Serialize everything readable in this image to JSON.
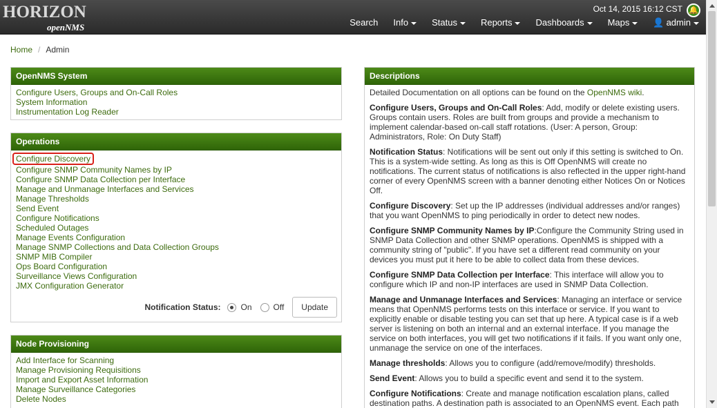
{
  "logo": {
    "brand": "HORIZON",
    "sub": "openNMS"
  },
  "header": {
    "clock": "Oct 14, 2015 16:12 CST",
    "menu": [
      {
        "label": "Search",
        "dropdown": false
      },
      {
        "label": "Info",
        "dropdown": true
      },
      {
        "label": "Status",
        "dropdown": true
      },
      {
        "label": "Reports",
        "dropdown": true
      },
      {
        "label": "Dashboards",
        "dropdown": true
      },
      {
        "label": "Maps",
        "dropdown": true
      }
    ],
    "user": "admin"
  },
  "breadcrumb": {
    "home": "Home",
    "current": "Admin"
  },
  "system": {
    "title": "OpenNMS System",
    "links": [
      "Configure Users, Groups and On-Call Roles",
      "System Information",
      "Instrumentation Log Reader"
    ]
  },
  "operations": {
    "title": "Operations",
    "links": [
      "Configure Discovery",
      "Configure SNMP Community Names by IP",
      "Configure SNMP Data Collection per Interface",
      "Manage and Unmanage Interfaces and Services",
      "Manage Thresholds",
      "Send Event",
      "Configure Notifications",
      "Scheduled Outages",
      "Manage Events Configuration",
      "Manage SNMP Collections and Data Collection Groups",
      "SNMP MIB Compiler",
      "Ops Board Configuration",
      "Surveillance Views Configuration",
      "JMX Configuration Generator"
    ],
    "notification_label": "Notification Status:",
    "on_label": "On",
    "off_label": "Off",
    "selected": "On",
    "update_label": "Update"
  },
  "provisioning": {
    "title": "Node Provisioning",
    "links": [
      "Add Interface for Scanning",
      "Manage Provisioning Requisitions",
      "Import and Export Asset Information",
      "Manage Surveillance Categories",
      "Delete Nodes"
    ]
  },
  "descriptions": {
    "title": "Descriptions",
    "intro": "Detailed Documentation on all options can be found on the ",
    "intro_link": "OpenNMS wiki",
    "intro_end": ".",
    "items": [
      {
        "term": "Configure Users, Groups and On-Call Roles",
        "text": ": Add, modify or delete existing users. Groups contain users. Roles are built from groups and provide a mechanism to implement calendar-based on-call staff rotations. (User: A person, Group: Administrators, Role: On Duty Staff)"
      },
      {
        "term": "Notification Status",
        "text": ": Notifications will be sent out only if this setting is switched to On. This is a system-wide setting. As long as this is Off OpenNMS will create no notifications. The current status of notifications is also reflected in the upper right-hand corner of every OpenNMS screen with a banner denoting either Notices On or Notices Off."
      },
      {
        "term": "Configure Discovery",
        "text": ": Set up the IP addresses (individual addresses and/or ranges) that you want OpenNMS to ping periodically in order to detect new nodes."
      },
      {
        "term": "Configure SNMP Community Names by IP",
        "text": ":Configure the Community String used in SNMP Data Collection and other SNMP operations. OpenNMS is shipped with a community string of \"public\". If you have set a different read community on your devices you must put it here to be able to collect data from these devices."
      },
      {
        "term": "Configure SNMP Data Collection per Interface",
        "text": ": This interface will allow you to configure which IP and non-IP interfaces are used in SNMP Data Collection."
      },
      {
        "term": "Manage and Unmanage Interfaces and Services",
        "text": ": Managing an interface or service means that OpenNMS performs tests on this interface or service. If you want to explicitly enable or disable testing you can set that up here. A typical case is if a web server is listening on both an internal and an external interface. If you manage the service on both interfaces, you will get two notifications if it fails. If you want only one, unmanage the service on one of the interfaces."
      },
      {
        "term": "Manage thresholds",
        "text": ": Allows you to configure (add/remove/modify) thresholds."
      },
      {
        "term": "Send Event",
        "text": ": Allows you to build a specific event and send it to the system."
      },
      {
        "term": "Configure Notifications",
        "text": ": Create and manage notification escalation plans, called destination paths. A destination path is associated to an OpenNMS event. Each path"
      }
    ]
  }
}
